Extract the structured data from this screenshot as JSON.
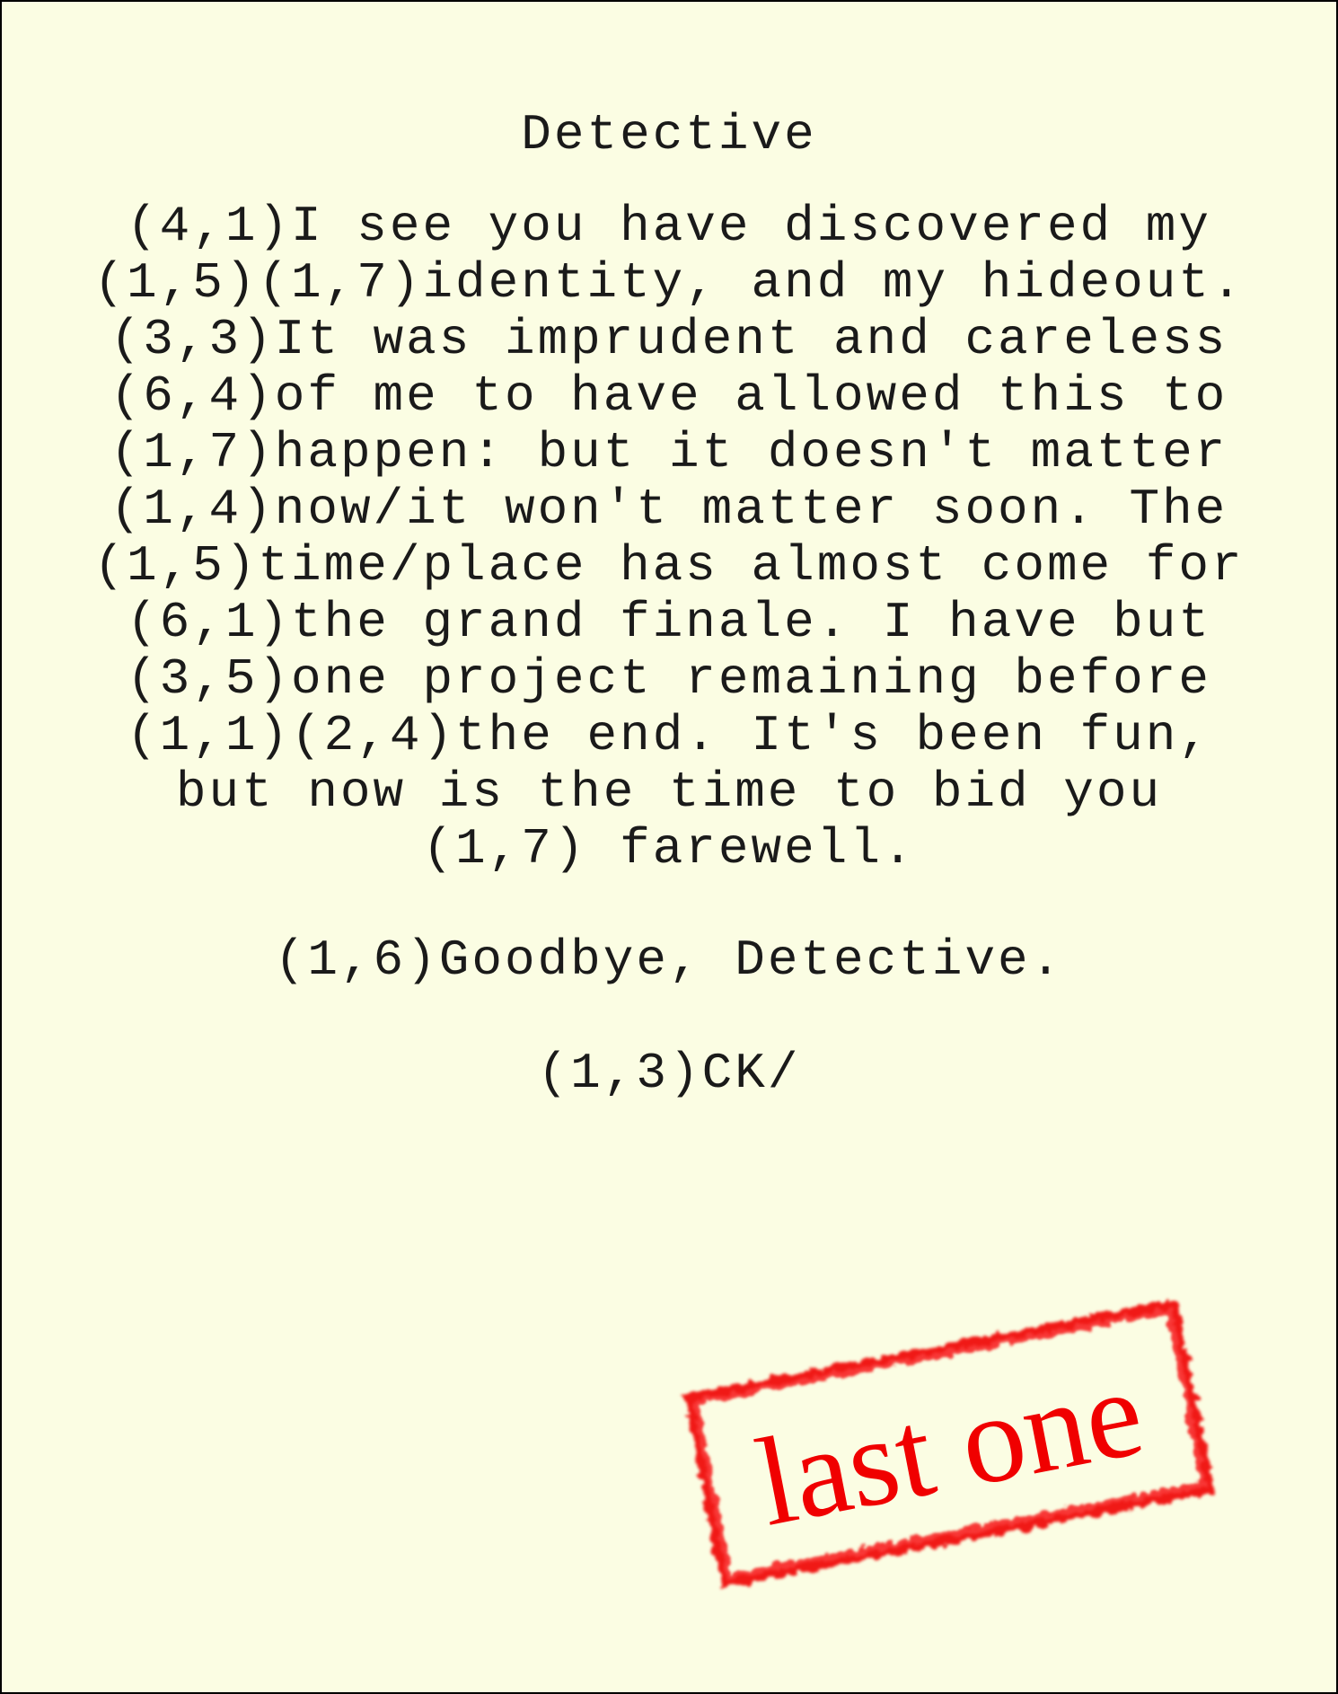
{
  "letter": {
    "salutation": "Detective",
    "body_lines": [
      "(4,1)I see you have discovered my",
      "(1,5)(1,7)identity, and my hideout.",
      "(3,3)It was imprudent and careless",
      "(6,4)of me to have allowed this to",
      "(1,7)happen: but it doesn't matter",
      "(1,4)now/it won't matter soon. The",
      "(1,5)time/place has almost come for",
      "(6,1)the grand finale. I have but",
      "(3,5)one project remaining before",
      "(1,1)(2,4)the end. It's been fun,",
      "but now is the time to bid you",
      "(1,7) farewell."
    ],
    "closing": "(1,6)Goodbye, Detective.",
    "signature": "(1,3)CK/"
  },
  "stamp": {
    "text": "last one",
    "color": "#f00000"
  },
  "colors": {
    "paper": "#fbfde3",
    "border": "#000000",
    "ink": "#1a1a1a"
  }
}
